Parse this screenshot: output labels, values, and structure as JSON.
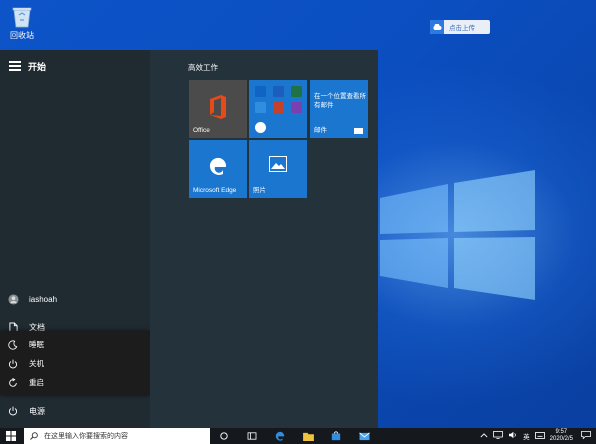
{
  "desktop": {
    "recycle_bin_label": "回收站",
    "cloud_badge_label": "点击上传"
  },
  "start_menu": {
    "title": "开始",
    "user": "iashoah",
    "documents": "文档",
    "power": "电源",
    "power_menu": {
      "sleep": "睡眠",
      "shutdown": "关机",
      "restart": "重启"
    },
    "group_title": "高效工作",
    "tiles": {
      "office": "Office",
      "mail_text": "在一个位置查看所有邮件",
      "mail": "邮件",
      "edge": "Microsoft Edge",
      "photos": "照片"
    }
  },
  "taskbar": {
    "search_placeholder": "在这里输入你要搜索的内容",
    "ime": "英",
    "time": "9:57",
    "date": "2020/2/5"
  },
  "icons": {
    "recycle_bin": "recycle-bin-icon",
    "cloud": "cloud-icon",
    "menu": "hamburger-icon",
    "user": "user-icon",
    "document": "document-icon",
    "sleep": "moon-icon",
    "shutdown": "power-icon",
    "restart": "restart-icon",
    "power": "power-icon"
  },
  "colors": {
    "accent": "#1a76cf",
    "start_menu_bg": "#1f2d35",
    "taskbar_bg": "#15191e"
  }
}
